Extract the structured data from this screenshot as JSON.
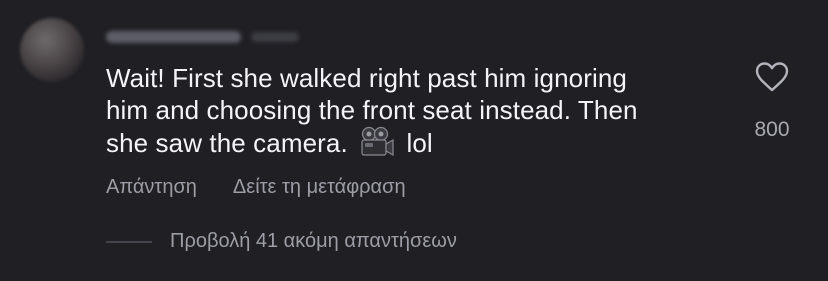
{
  "comment": {
    "text_line1": "Wait! First she walked right past him ignoring",
    "text_line2": "him and choosing the front seat instead. Then",
    "text_line3_a": "she saw the camera.",
    "text_line3_b": "lol",
    "emoji": "movie-camera-emoji"
  },
  "like": {
    "icon": "heart-icon",
    "count": "800"
  },
  "actions": {
    "reply_label": "Απάντηση",
    "translate_label": "Δείτε τη μετάφραση"
  },
  "replies": {
    "view_more_label": "Προβολή 41 ακόμη απαντήσεων"
  }
}
